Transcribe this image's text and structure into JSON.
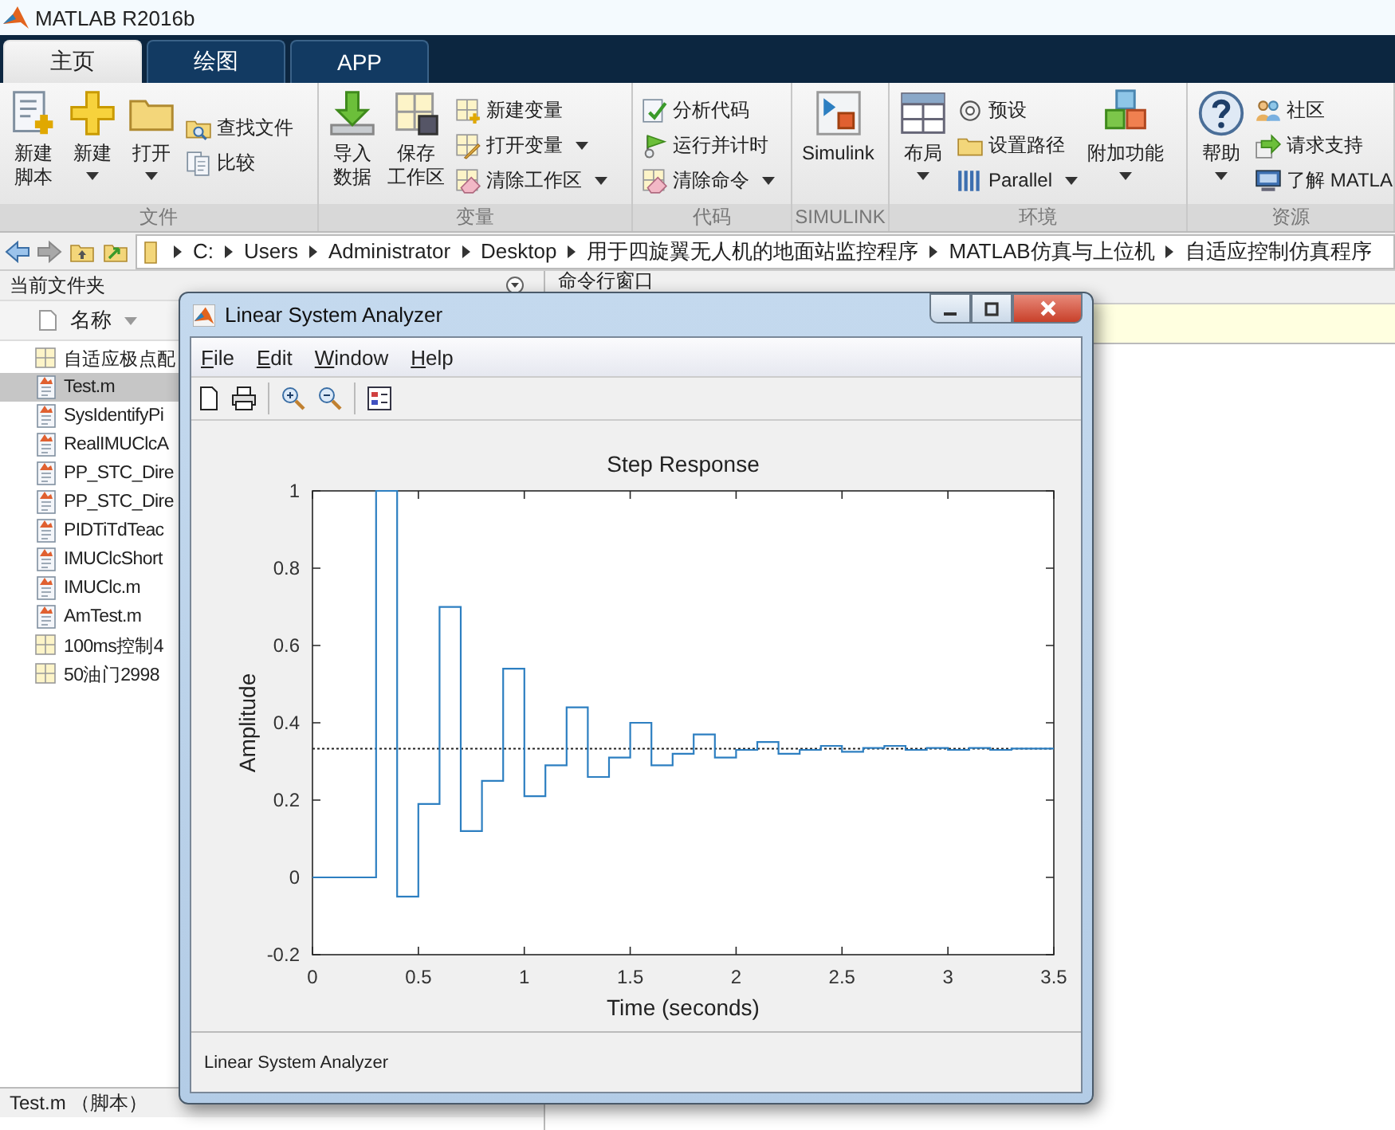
{
  "title_bar": {
    "title": "MATLAB R2016b"
  },
  "tabs": [
    {
      "label": "主页",
      "selected": true
    },
    {
      "label": "绘图",
      "selected": false
    },
    {
      "label": "APP",
      "selected": false
    }
  ],
  "toolstrip": [
    {
      "label": "文件",
      "items": [
        {
          "kind": "large",
          "label": [
            "新建",
            "脚本"
          ],
          "dropdown": false
        },
        {
          "kind": "large",
          "label": [
            "新建"
          ],
          "dropdown": true
        },
        {
          "kind": "large",
          "label": [
            "打开"
          ],
          "dropdown": true
        },
        {
          "kind": "small",
          "label": "查找文件",
          "dropdown": false
        },
        {
          "kind": "small",
          "label": "比较",
          "dropdown": false
        }
      ]
    },
    {
      "label": "变量",
      "items": [
        {
          "kind": "large",
          "label": [
            "导入",
            "数据"
          ],
          "dropdown": false
        },
        {
          "kind": "large",
          "label": [
            "保存",
            "工作区"
          ],
          "dropdown": false
        },
        {
          "kind": "small",
          "label": "新建变量",
          "dropdown": false
        },
        {
          "kind": "small",
          "label": "打开变量",
          "dropdown": true
        },
        {
          "kind": "small",
          "label": "清除工作区",
          "dropdown": true
        }
      ]
    },
    {
      "label": "代码",
      "items": [
        {
          "kind": "small",
          "label": "分析代码",
          "dropdown": false
        },
        {
          "kind": "small",
          "label": "运行并计时",
          "dropdown": false
        },
        {
          "kind": "small",
          "label": "清除命令",
          "dropdown": true
        }
      ]
    },
    {
      "label": "SIMULINK",
      "items": [
        {
          "kind": "large",
          "label": [
            "Simulink"
          ],
          "dropdown": false
        }
      ]
    },
    {
      "label": "环境",
      "items": [
        {
          "kind": "large",
          "label": [
            "布局"
          ],
          "dropdown": true
        },
        {
          "kind": "small",
          "label": "预设",
          "dropdown": false
        },
        {
          "kind": "small",
          "label": "设置路径",
          "dropdown": false
        },
        {
          "kind": "small",
          "label": "Parallel",
          "dropdown": true
        },
        {
          "kind": "large",
          "label": [
            "附加功能"
          ],
          "dropdown": true
        }
      ]
    },
    {
      "label": "资源",
      "items": [
        {
          "kind": "large",
          "label": [
            "帮助"
          ],
          "dropdown": true
        },
        {
          "kind": "small",
          "label": "社区",
          "dropdown": false
        },
        {
          "kind": "small",
          "label": "请求支持",
          "dropdown": false
        },
        {
          "kind": "small",
          "label": "了解 MATLA"
        }
      ]
    }
  ],
  "address_bar": {
    "path": [
      "C:",
      "Users",
      "Administrator",
      "Desktop",
      "用于四旋翼无人机的地面站监控程序",
      "MATLAB仿真与上位机",
      "自适应控制仿真程序"
    ]
  },
  "current_folder": {
    "title": "当前文件夹",
    "column": "名称",
    "files": [
      {
        "name": "自适应极点配",
        "kind": "data",
        "selected": false
      },
      {
        "name": "Test.m",
        "kind": "script",
        "selected": true
      },
      {
        "name": "SysIdentifyPi",
        "kind": "script",
        "selected": false
      },
      {
        "name": "RealIMUClcA",
        "kind": "script",
        "selected": false
      },
      {
        "name": "PP_STC_Dire",
        "kind": "script",
        "selected": false
      },
      {
        "name": "PP_STC_Dire",
        "kind": "script",
        "selected": false
      },
      {
        "name": "PIDTiTdTeac",
        "kind": "script",
        "selected": false
      },
      {
        "name": "IMUClcShort",
        "kind": "script",
        "selected": false
      },
      {
        "name": "IMUClc.m",
        "kind": "script",
        "selected": false
      },
      {
        "name": "AmTest.m",
        "kind": "script",
        "selected": false
      },
      {
        "name": "100ms控制4",
        "kind": "data",
        "selected": false
      },
      {
        "name": "50油门2998",
        "kind": "data",
        "selected": false
      }
    ],
    "details": "Test.m （脚本）"
  },
  "command_window": {
    "title": "命令行窗口"
  },
  "analyzer_window": {
    "title": "Linear System Analyzer",
    "menu": [
      "File",
      "Edit",
      "Window",
      "Help"
    ],
    "status": "Linear System Analyzer",
    "chart_data": {
      "type": "line",
      "title": "Step Response",
      "xlabel": "Time (seconds)",
      "ylabel": "Amplitude",
      "x": [
        0,
        0.3,
        0.3,
        0.4,
        0.4,
        0.5,
        0.5,
        0.6,
        0.6,
        0.7,
        0.7,
        0.8,
        0.8,
        0.9,
        0.9,
        1,
        1,
        1.1,
        1.1,
        1.2,
        1.2,
        1.3,
        1.3,
        1.4,
        1.4,
        1.5,
        1.5,
        1.6,
        1.6,
        1.7,
        1.7,
        1.8,
        1.8,
        1.9,
        1.9,
        2,
        2,
        2.1,
        2.1,
        2.2,
        2.2,
        2.3,
        2.3,
        2.4,
        2.4,
        2.5,
        2.5,
        2.6,
        2.6,
        2.7,
        2.7,
        2.8,
        2.8,
        2.9,
        2.9,
        3,
        3,
        3.1,
        3.1,
        3.2,
        3.2,
        3.3,
        3.3,
        3.5
      ],
      "values": [
        0,
        0,
        1,
        1,
        -0.05,
        -0.05,
        0.19,
        0.19,
        0.7,
        0.7,
        0.12,
        0.12,
        0.25,
        0.25,
        0.54,
        0.54,
        0.21,
        0.21,
        0.29,
        0.29,
        0.44,
        0.44,
        0.26,
        0.26,
        0.31,
        0.31,
        0.4,
        0.4,
        0.29,
        0.29,
        0.32,
        0.32,
        0.37,
        0.37,
        0.31,
        0.31,
        0.33,
        0.33,
        0.35,
        0.35,
        0.32,
        0.32,
        0.33,
        0.33,
        0.34,
        0.34,
        0.325,
        0.325,
        0.335,
        0.335,
        0.34,
        0.34,
        0.33,
        0.33,
        0.335,
        0.335,
        0.33,
        0.33,
        0.335,
        0.335,
        0.33,
        0.33,
        0.333,
        0.333
      ],
      "xlim": [
        0,
        3.5
      ],
      "ylim": [
        -0.2,
        1
      ],
      "xticks": [
        0,
        0.5,
        1,
        1.5,
        2,
        2.5,
        3,
        3.5
      ],
      "yticks": [
        -0.2,
        0,
        0.2,
        0.4,
        0.6,
        0.8,
        1
      ],
      "ref_lines": [
        {
          "axis": "y",
          "value": 0.333
        }
      ]
    }
  }
}
